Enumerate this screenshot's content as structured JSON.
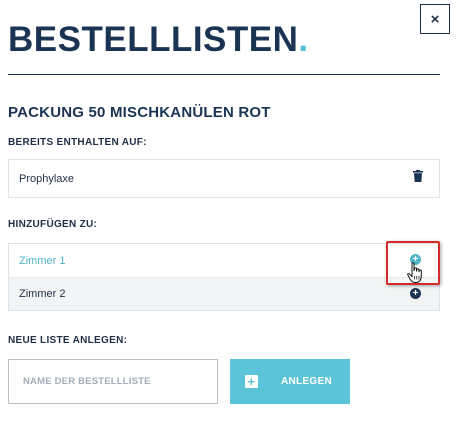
{
  "dialog": {
    "title": "BESTELLLISTEN",
    "title_dot": ".",
    "close_label": "×"
  },
  "product": {
    "name": "PACKUNG 50 MISCHKANÜLEN ROT"
  },
  "contained": {
    "label": "BEREITS ENTHALTEN AUF:",
    "items": [
      {
        "name": "Prophylaxe",
        "icon": "trash-icon"
      }
    ]
  },
  "add_to": {
    "label": "HINZUFÜGEN ZU:",
    "items": [
      {
        "name": "Zimmer 1",
        "icon": "plus-circle-icon",
        "state": "hover"
      },
      {
        "name": "Zimmer 2",
        "icon": "plus-circle-icon",
        "state": "normal"
      }
    ]
  },
  "new_list": {
    "label": "NEUE LISTE ANLEGEN:",
    "input_placeholder": "NAME DER BESTELLLISTE",
    "input_value": "",
    "button_label": "ANLEGEN",
    "button_icon": "plus-square-icon"
  },
  "colors": {
    "primary": "#1c3454",
    "accent": "#4fc0d8",
    "button": "#5bc4d8",
    "highlight": "#d42a2a"
  }
}
